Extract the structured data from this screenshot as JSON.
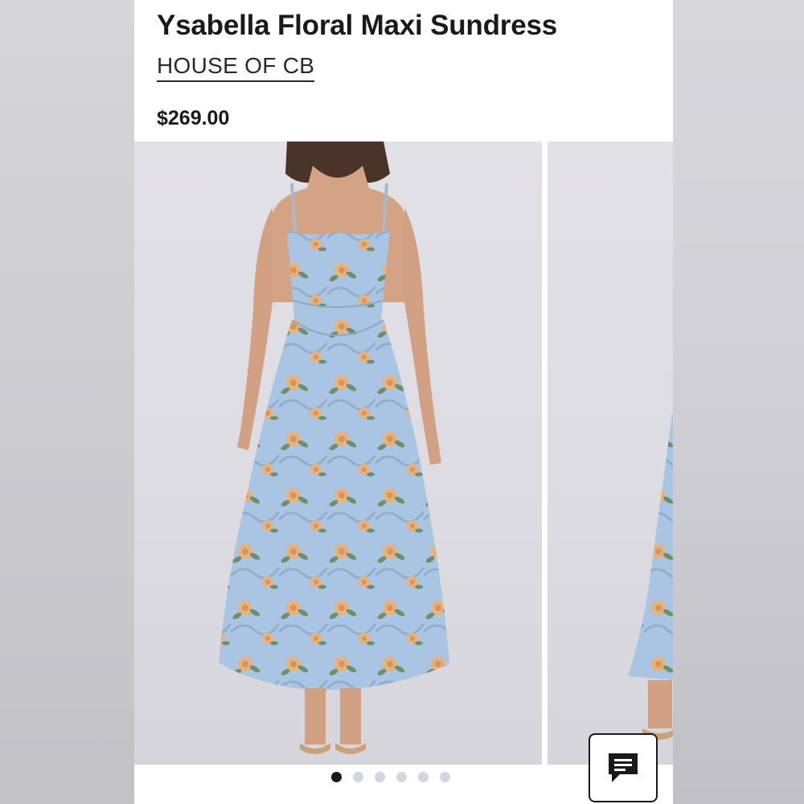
{
  "product": {
    "title": "Ysabella Floral Maxi Sundress",
    "brand": "HOUSE OF CB",
    "price": "$269.00"
  },
  "gallery": {
    "slides": [
      {
        "subject": "model wearing light blue floral maxi sundress, front view"
      },
      {
        "subject": "partial view of dress hem and sandal"
      }
    ],
    "dot_count": 6,
    "active_dot": 1
  },
  "chat": {
    "icon": "chat-bubble-icon"
  },
  "colors": {
    "dress_blue": "#aac4e4",
    "flower_peach": "#e8b27a",
    "leaf_green": "#6f8f6a",
    "text": "#1a1a1a"
  }
}
